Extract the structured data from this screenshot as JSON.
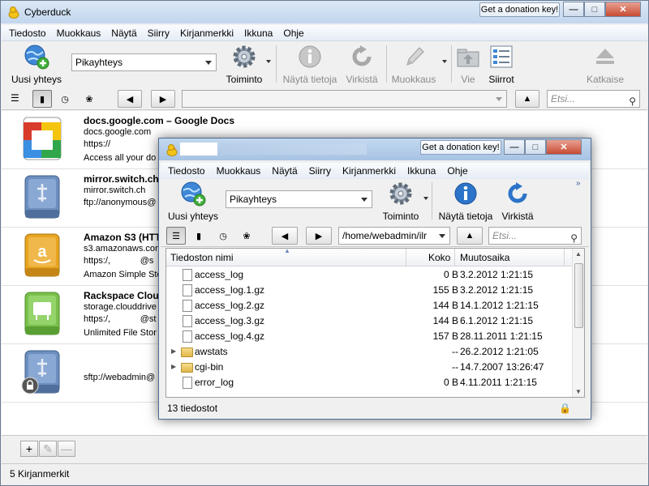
{
  "main": {
    "title": "Cyberduck",
    "donate": "Get a donation key!",
    "menu": [
      "Tiedosto",
      "Muokkaus",
      "Näytä",
      "Siirry",
      "Kirjanmerkki",
      "Ikkuna",
      "Ohje"
    ],
    "toolbar": {
      "new_connection": "Uusi yhteys",
      "quick_connect": "Pikayhteys",
      "action": "Toiminto",
      "info": "Näytä tietoja",
      "refresh": "Virkistä",
      "edit": "Muokkaus",
      "upload": "Vie",
      "transfers": "Siirrot",
      "disconnect": "Katkaise yhteys"
    },
    "search_placeholder": "Etsi...",
    "bookmarks": [
      {
        "title": "docs.google.com – Google Docs",
        "host": "docs.google.com",
        "url": "https://",
        "desc": "Access all your do"
      },
      {
        "title": "mirror.switch.ch",
        "host": "mirror.switch.ch",
        "url": "ftp://anonymous@",
        "desc": ""
      },
      {
        "title": "Amazon S3 (HTT",
        "host": "s3.amazonaws.com",
        "url": "https:/,            @s",
        "desc": "Amazon Simple Sto"
      },
      {
        "title": "Rackspace Cloud",
        "host": "storage.clouddrive",
        "url": "https:/,            @st",
        "desc": "Unlimited File Stor"
      },
      {
        "title": "",
        "host": "",
        "url": "sftp://webadmin@",
        "desc": ""
      }
    ],
    "status": "5 Kirjanmerkit"
  },
  "browser": {
    "donate": "Get a donation key!",
    "menu": [
      "Tiedosto",
      "Muokkaus",
      "Näytä",
      "Siirry",
      "Kirjanmerkki",
      "Ikkuna",
      "Ohje"
    ],
    "toolbar": {
      "new_connection": "Uusi yhteys",
      "quick_connect": "Pikayhteys",
      "action": "Toiminto",
      "info": "Näytä tietoja",
      "refresh": "Virkistä"
    },
    "path": "/home/webadmin/ilr",
    "search_placeholder": "Etsi...",
    "columns": {
      "name": "Tiedoston nimi",
      "size": "Koko",
      "modified": "Muutosaika"
    },
    "files": [
      {
        "name": "access_log",
        "size": "0 B",
        "modified": "3.2.2012 1:21:15",
        "type": "file"
      },
      {
        "name": "access_log.1.gz",
        "size": "155 B",
        "modified": "3.2.2012 1:21:15",
        "type": "file"
      },
      {
        "name": "access_log.2.gz",
        "size": "144 B",
        "modified": "14.1.2012 1:21:15",
        "type": "file"
      },
      {
        "name": "access_log.3.gz",
        "size": "144 B",
        "modified": "6.1.2012 1:21:15",
        "type": "file"
      },
      {
        "name": "access_log.4.gz",
        "size": "157 B",
        "modified": "28.11.2011 1:21:15",
        "type": "file"
      },
      {
        "name": "awstats",
        "size": "--",
        "modified": "26.2.2012 1:21:05",
        "type": "folder"
      },
      {
        "name": "cgi-bin",
        "size": "--",
        "modified": "14.7.2007 13:26:47",
        "type": "folder"
      },
      {
        "name": "error_log",
        "size": "0 B",
        "modified": "4.11.2011 1:21:15",
        "type": "file"
      }
    ],
    "status": "13 tiedostot"
  }
}
